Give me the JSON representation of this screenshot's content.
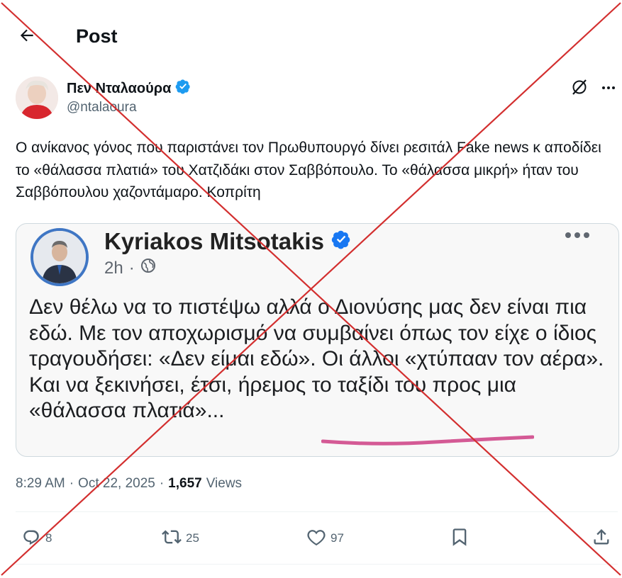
{
  "header": {
    "title": "Post"
  },
  "author": {
    "name": "Πεν Νταλαούρα",
    "handle": "@ntalaoura",
    "verified": true
  },
  "tweet": {
    "text": "Ο ανίκανος γόνος που παριστάνει τον Πρωθυπουργό δίνει ρεσιτάλ Fake news κ αποδίδει το «θάλασσα πλατιά» του Χατζιδάκι στον Σαββόπουλο. Το «θάλασσα μικρή» ήταν του Σαββόπουλου χαζοντάμαρο. Κοπρίτη"
  },
  "media": {
    "author_name": "Kyriakos Mitsotakis",
    "time": "2h",
    "body": "Δεν θέλω να το πιστέψω αλλά ο Διονύσης μας δεν είναι πια εδώ. Με τον αποχωρισμό να συμβαίνει όπως τον είχε ο ίδιος τραγουδήσει: «Δεν είμαι εδώ». Οι άλλοι «χτύπααν τον αέρα». Και να ξεκινήσει, έτσι, ήρεμος το ταξίδι του προς μια «θάλασσα πλατιά»..."
  },
  "meta": {
    "time": "8:29 AM",
    "date": "Oct 22, 2025",
    "views_count": "1,657",
    "views_label": "Views"
  },
  "actions": {
    "replies": "8",
    "reposts": "25",
    "likes": "97"
  },
  "colors": {
    "verified": "#1d9bf0",
    "cross": "#d32f2f",
    "underline": "#d45a95"
  },
  "icons": [
    "back-arrow-icon",
    "verified-badge-icon",
    "grok-icon",
    "more-icon",
    "globe-icon",
    "reply-icon",
    "repost-icon",
    "like-icon",
    "bookmark-icon",
    "share-icon"
  ]
}
